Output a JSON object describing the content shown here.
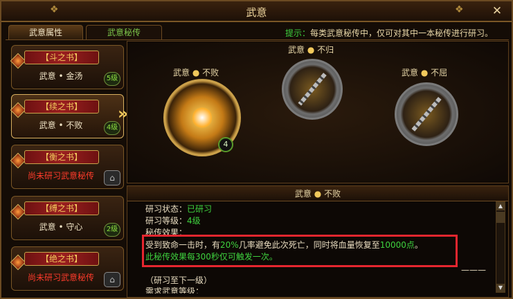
{
  "window": {
    "title": "武意",
    "close_label": "✕"
  },
  "tabs": [
    {
      "label": "武意属性"
    },
    {
      "label": "武意秘传"
    }
  ],
  "hint": {
    "prefix": "提示：",
    "text": "每类武意秘传中，仅可对其中一本秘传进行研习。"
  },
  "books": [
    {
      "title": "【斗之书】",
      "sub": "武意 • 金汤",
      "level": "5级"
    },
    {
      "title": "【续之书】",
      "sub": "武意 • 不败",
      "level": "4级"
    },
    {
      "title": "【衡之书】",
      "sub": "尚未研习武意秘传"
    },
    {
      "title": "【缚之书】",
      "sub": "武意 • 守心",
      "level": "2级"
    },
    {
      "title": "【绝之书】",
      "sub": "尚未研习武意秘传"
    }
  ],
  "slots": [
    {
      "label_a": "武意",
      "label_b": "不败",
      "level": "4"
    },
    {
      "label_a": "武意",
      "label_b": "不归"
    },
    {
      "label_a": "武意",
      "label_b": "不屈"
    }
  ],
  "detail": {
    "title_a": "武意",
    "title_b": "不败",
    "state_label": "研习状态：",
    "state_value": "已研习",
    "level_label": "研习等级：",
    "level_value": "4级",
    "effect_label": "秘传效果：",
    "effect_1a": "受到致命一击时，有",
    "effect_1b": "20%",
    "effect_1c": "几率避免此次死亡，同时将血量恢复至",
    "effect_1d": "10000点",
    "effect_1e": "。",
    "effect_2": "此秘传效果每300秒仅可触发一次。",
    "dashes": "———",
    "next_label": "（研习至下一级）",
    "req_label": "需求武意等级："
  },
  "icons": {
    "close": "close-icon",
    "arrow": "chevron-right-icon",
    "lock": "lock-icon",
    "gem": "gem-icon"
  },
  "colors": {
    "accent": "#f2c95c",
    "green": "#3ed23e",
    "red": "#ff3b2b",
    "highlight_box": "#e5262f"
  }
}
